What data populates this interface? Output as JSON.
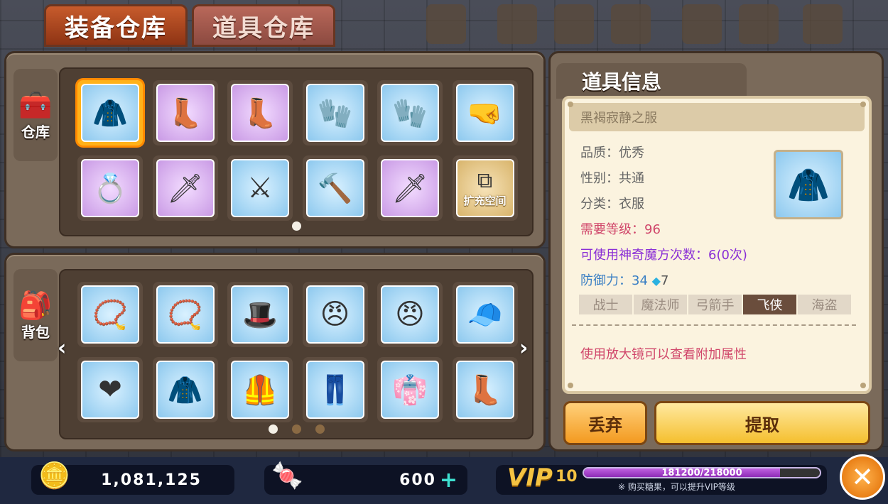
{
  "tabs": {
    "equipment": "装备仓库",
    "items": "道具仓库"
  },
  "side_tabs": {
    "warehouse": "仓库",
    "bag": "背包"
  },
  "warehouse": {
    "slots": [
      {
        "icon": "🧥",
        "rarity": "blue",
        "selected": true
      },
      {
        "icon": "👢",
        "rarity": "purple"
      },
      {
        "icon": "👢",
        "rarity": "purple"
      },
      {
        "icon": "🧤",
        "rarity": "blue"
      },
      {
        "icon": "🧤",
        "rarity": "blue"
      },
      {
        "icon": "🤜",
        "rarity": "blue"
      },
      {
        "icon": "💍",
        "rarity": "purple"
      },
      {
        "icon": "🗡",
        "rarity": "purple"
      },
      {
        "icon": "⚔",
        "rarity": "blue"
      },
      {
        "icon": "🔨",
        "rarity": "blue"
      },
      {
        "icon": "🗡",
        "rarity": "purple"
      }
    ],
    "expand_label": "扩充空间"
  },
  "bag": {
    "slots": [
      {
        "icon": "📿",
        "rarity": "blue"
      },
      {
        "icon": "📿",
        "rarity": "blue"
      },
      {
        "icon": "🎩",
        "rarity": "blue"
      },
      {
        "icon": "😠",
        "rarity": "blue"
      },
      {
        "icon": "😠",
        "rarity": "blue"
      },
      {
        "icon": "🧢",
        "rarity": "blue"
      },
      {
        "icon": "❤",
        "rarity": "blue"
      },
      {
        "icon": "🧥",
        "rarity": "blue"
      },
      {
        "icon": "🦺",
        "rarity": "blue"
      },
      {
        "icon": "👖",
        "rarity": "blue"
      },
      {
        "icon": "👘",
        "rarity": "blue"
      },
      {
        "icon": "👢",
        "rarity": "blue"
      }
    ]
  },
  "info": {
    "title": "道具信息",
    "item_name": "黑褐寂静之服",
    "quality": "品质：优秀",
    "gender": "性别：共通",
    "category": "分类：衣服",
    "level_req": "需要等级：96",
    "cube_uses": "可使用神奇魔方次数：6(0次)",
    "defense_label": "防御力：34",
    "defense_bonus": "7",
    "jobs": [
      "战士",
      "魔法师",
      "弓箭手",
      "飞侠",
      "海盗"
    ],
    "active_job": 3,
    "hint": "使用放大镜可以查看附加属性"
  },
  "buttons": {
    "discard": "丢弃",
    "extract": "提取"
  },
  "currency": {
    "gold": "1,081,125",
    "candy": "600"
  },
  "vip": {
    "label": "VIP",
    "level": "10",
    "progress_text": "181200/218000",
    "progress": 0.831,
    "note": "※ 购买糖果，可以提升VIP等级"
  }
}
